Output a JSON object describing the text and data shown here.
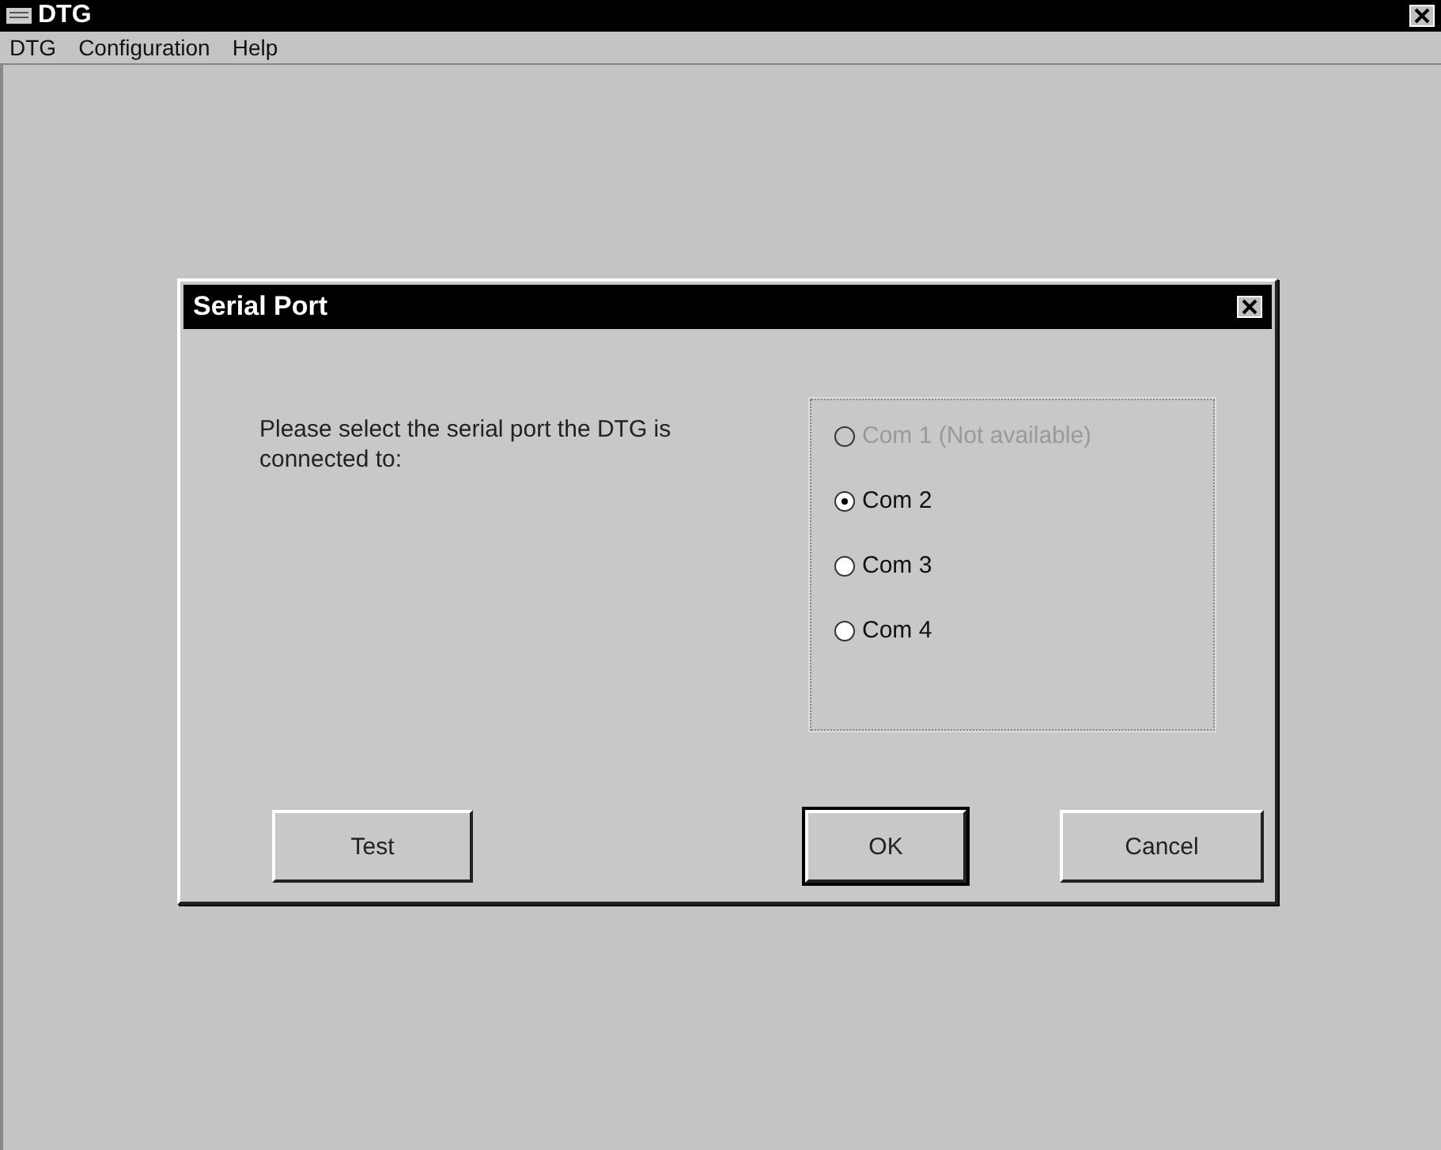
{
  "window": {
    "title": "DTG"
  },
  "menu": [
    {
      "label": "DTG"
    },
    {
      "label": "Configuration"
    },
    {
      "label": "Help"
    }
  ],
  "dialog": {
    "title": "Serial Port",
    "prompt": "Please select the serial port the DTG is connected to:",
    "ports": [
      {
        "label": "Com 1 (Not available)",
        "selected": false,
        "disabled": true
      },
      {
        "label": "Com 2",
        "selected": true,
        "disabled": false
      },
      {
        "label": "Com 3",
        "selected": false,
        "disabled": false
      },
      {
        "label": "Com 4",
        "selected": false,
        "disabled": false
      }
    ],
    "buttons": [
      {
        "label": "Test",
        "default": false
      },
      {
        "label": "OK",
        "default": true
      },
      {
        "label": "Cancel",
        "default": false
      }
    ]
  }
}
